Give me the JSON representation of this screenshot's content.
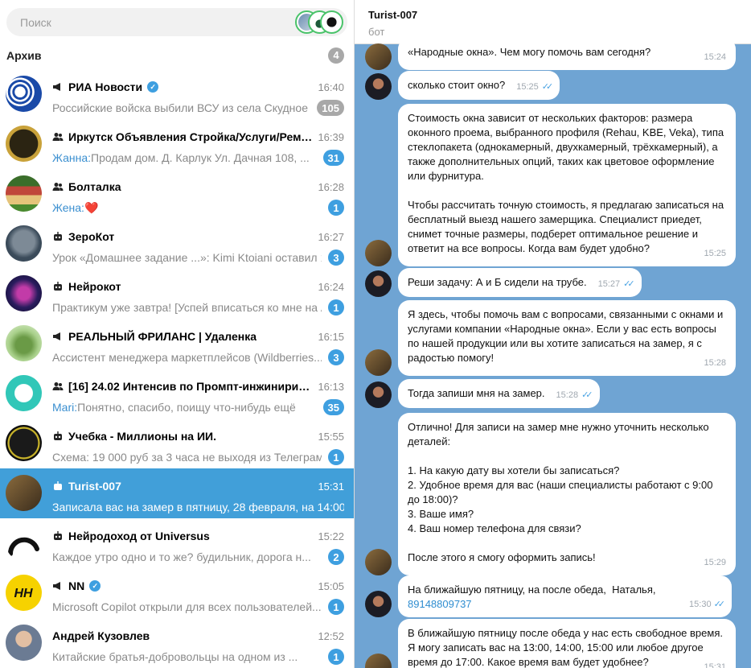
{
  "search": {
    "placeholder": "Поиск"
  },
  "archive": {
    "label": "Архив",
    "count": "4"
  },
  "chats": [
    {
      "name": "РИА Новости",
      "time": "16:40",
      "sender": "",
      "preview": "Российские войска выбили ВСУ из села Скудное на ...",
      "badge": "105",
      "badge_color": "gray",
      "type_icon": "megaphone-icon",
      "verified": true,
      "avatar": "ria-logo"
    },
    {
      "name": "Иркутск Объявления Стройка/Услуги/Ремонт...",
      "time": "16:39",
      "sender": "Жанна:",
      "preview": "Продам дом. Д. Карлук  Ул. Дачная 108, ...",
      "badge": "31",
      "badge_color": "blue",
      "type_icon": "group-icon",
      "verified": false,
      "avatar": "board-logo"
    },
    {
      "name": "Болталка",
      "time": "16:28",
      "sender": "Жена:",
      "preview": "❤️",
      "badge": "1",
      "badge_color": "blue",
      "type_icon": "group-icon",
      "verified": false,
      "avatar": "house-avatar"
    },
    {
      "name": "ЗероКот",
      "time": "16:27",
      "sender": "",
      "preview": "Урок «Домашнее задание ...»:  Kimi Ktoiani  оставил 1 ...",
      "badge": "3",
      "badge_color": "blue",
      "type_icon": "bot-icon",
      "verified": false,
      "avatar": "cat-avatar"
    },
    {
      "name": "Нейрокот",
      "time": "16:24",
      "sender": "",
      "preview": "Практикум уже завтра! [Успей вписаться ко мне на AI...",
      "badge": "1",
      "badge_color": "blue",
      "type_icon": "bot-icon",
      "verified": false,
      "avatar": "neon-cat-avatar"
    },
    {
      "name": "РЕАЛЬНЫЙ ФРИЛАНС | Удаленка",
      "time": "16:15",
      "sender": "",
      "preview": "Ассистент менеджера маркетплейсов (Wildberries...",
      "badge": "3",
      "badge_color": "blue",
      "type_icon": "megaphone-icon",
      "verified": false,
      "avatar": "freelancer-avatar"
    },
    {
      "name": "[16] 24.02 Интенсив по Промпт-инжинирингу",
      "time": "16:13",
      "sender": "Mari:",
      "preview": "Понятно, спасибо,  поищу что-нибудь ещё",
      "badge": "35",
      "badge_color": "blue",
      "type_icon": "group-icon",
      "verified": false,
      "avatar": "prompt-avatar"
    },
    {
      "name": "Учебка - Миллионы на ИИ.",
      "time": "15:55",
      "sender": "",
      "preview": "Схема: 19 000 руб за 3 часа не выходя из Телеграм   С...",
      "badge": "1",
      "badge_color": "blue",
      "type_icon": "bot-icon",
      "verified": false,
      "avatar": "millions-avatar"
    },
    {
      "name": "Turist-007",
      "time": "15:31",
      "sender": "",
      "preview": "Записала вас на замер в пятницу, 28 февраля, на 14:00. Н...",
      "badge": "",
      "badge_color": "",
      "type_icon": "bot-icon",
      "verified": false,
      "avatar": "book-avatar",
      "active": true
    },
    {
      "name": "Нейродоход от Universus",
      "time": "15:22",
      "sender": "",
      "preview": "Каждое утро одно и то же?   будильник, дорога н...",
      "badge": "2",
      "badge_color": "blue",
      "type_icon": "bot-icon",
      "verified": false,
      "avatar": "arc-logo"
    },
    {
      "name": "NN",
      "time": "15:05",
      "sender": "",
      "preview": "Microsoft Copilot открыли для всех пользователей...",
      "badge": "1",
      "badge_color": "blue",
      "type_icon": "megaphone-icon",
      "verified": true,
      "avatar": "nn-logo"
    },
    {
      "name": "Андрей Кузовлев",
      "time": "12:52",
      "sender": "",
      "preview": "Китайские братья-добровольцы на одном из ...",
      "badge": "1",
      "badge_color": "blue",
      "type_icon": "",
      "verified": false,
      "avatar": "person-avatar"
    }
  ],
  "header": {
    "name": "Turist-007",
    "status": "бот"
  },
  "messages": [
    {
      "from": "bot",
      "text": "«Народные окна». Чем могу помочь вам сегодня?",
      "time": "15:24"
    },
    {
      "from": "me",
      "text": "сколько стоит окно?",
      "time": "15:25"
    },
    {
      "from": "bot",
      "text": "Стоимость окна зависит от нескольких факторов: размера оконного проема, выбранного профиля (Rehau, KBE, Veka), типа стеклопакета (однокамерный, двухкамерный, трёхкамерный), а также дополнительных опций, таких как цветовое оформление или фурнитура.\n\nЧтобы рассчитать точную стоимость, я предлагаю записаться на бесплатный выезд нашего замерщика. Специалист приедет, снимет точные размеры, подберет оптимальное решение и ответит на все вопросы. Когда вам будет удобно?",
      "time": "15:25"
    },
    {
      "from": "me",
      "text": "Реши задачу: А и Б сидели на трубе.",
      "time": "15:27"
    },
    {
      "from": "bot",
      "text": "Я здесь, чтобы помочь вам с вопросами, связанными с окнами и услугами компании «Народные окна». Если у вас есть вопросы по нашей продукции или вы хотите записаться на замер, я с радостью помогу!",
      "time": "15:28"
    },
    {
      "from": "me",
      "text": "Тогда запиши мня на замер.",
      "time": "15:28"
    },
    {
      "from": "bot",
      "text": "Отлично! Для записи на замер мне нужно уточнить несколько деталей:\n\n1. На какую дату вы хотели бы записаться?\n2. Удобное время для вас (наши специалисты работают с 9:00 до 18:00)?\n3. Ваше имя?\n4. Ваш номер телефона для связи?\n\nПосле этого я смогу оформить запись!",
      "time": "15:29"
    },
    {
      "from": "me",
      "text": "На ближайшую пятницу, на после обеда,  Наталья, ",
      "phone": "89148809737",
      "time": "15:30"
    },
    {
      "from": "bot",
      "text": "В ближайшую пятницу после обеда у нас есть свободное время. Я могу записать вас на 13:00, 14:00, 15:00 или любое другое время до 17:00. Какое время вам будет удобнее?",
      "time": "15:31"
    }
  ],
  "colors": {
    "accent": "#419fd9",
    "chat_bg": "#6fa4d3",
    "badge_blue": "#3e9fe0",
    "badge_gray": "#a8a8a8"
  }
}
